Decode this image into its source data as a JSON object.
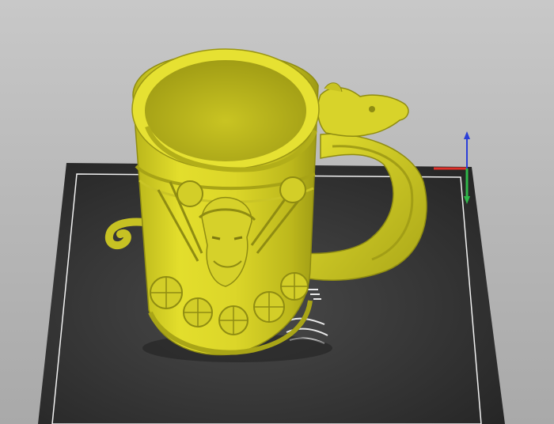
{
  "app": {
    "view": "3d-viewport"
  },
  "scene": {
    "model": {
      "name": "",
      "color": "#d9d426",
      "shade_color": "#a8a416",
      "highlight_color": "#efe96a"
    },
    "build_plate": {
      "color": "#2b2b2b",
      "border_color": "#f2f2f2"
    },
    "axes": {
      "x_color": "#e0312a",
      "y_color": "#2fb84a",
      "z_color": "#2b3fd8"
    }
  }
}
